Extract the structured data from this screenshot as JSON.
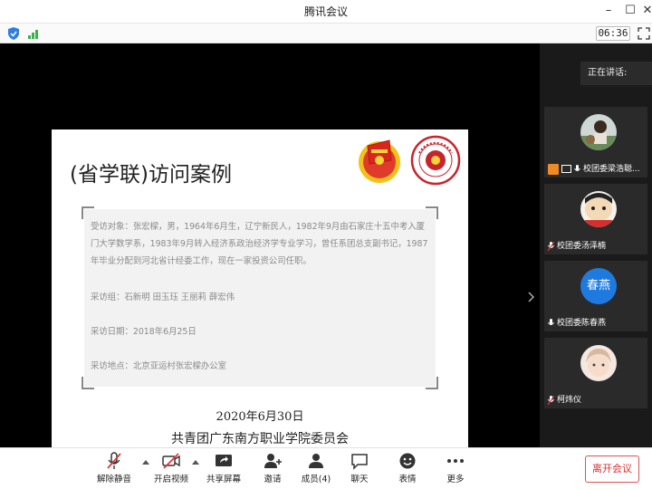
{
  "window": {
    "title": "腾讯会议",
    "timer": "06:36"
  },
  "slide": {
    "title": "(省学联)访问案例",
    "paragraphs": [
      "受访对象：张宏樑，男，1964年6月生，辽宁新民人，1982年9月由石家庄十五中考入厦门大学数学系，1983年9月转入经济系政治经济学专业学习，曾任系团总支副书记，1987年毕业分配到河北省计经委工作，现在一家投资公司任职。",
      "采访组：石新明 田玉珏 王丽莉 薛宏伟",
      "采访日期：2018年6月25日",
      "采访地点：北京亚运村张宏樑办公室"
    ],
    "date": "2020年6月30日",
    "org": "共青团广东南方职业学院委员会"
  },
  "side_panel": {
    "speaking_label": "正在讲话:",
    "participants": [
      {
        "name": "校团委梁浩聪..."
      },
      {
        "name": "校团委汤泽楠"
      },
      {
        "name": "校团委陈春燕",
        "avatar_text": "春燕"
      },
      {
        "name": "柯炜仪"
      }
    ]
  },
  "toolbar": {
    "unmute": "解除静音",
    "video": "开启视频",
    "share": "共享屏幕",
    "invite": "邀请",
    "members": "成员(4)",
    "chat": "聊天",
    "emoji": "表情",
    "more": "更多",
    "leave": "离开会议"
  },
  "colors": {
    "leave": "#d93030",
    "accent_blue": "#1f7ae0",
    "orange": "#f08a24"
  }
}
